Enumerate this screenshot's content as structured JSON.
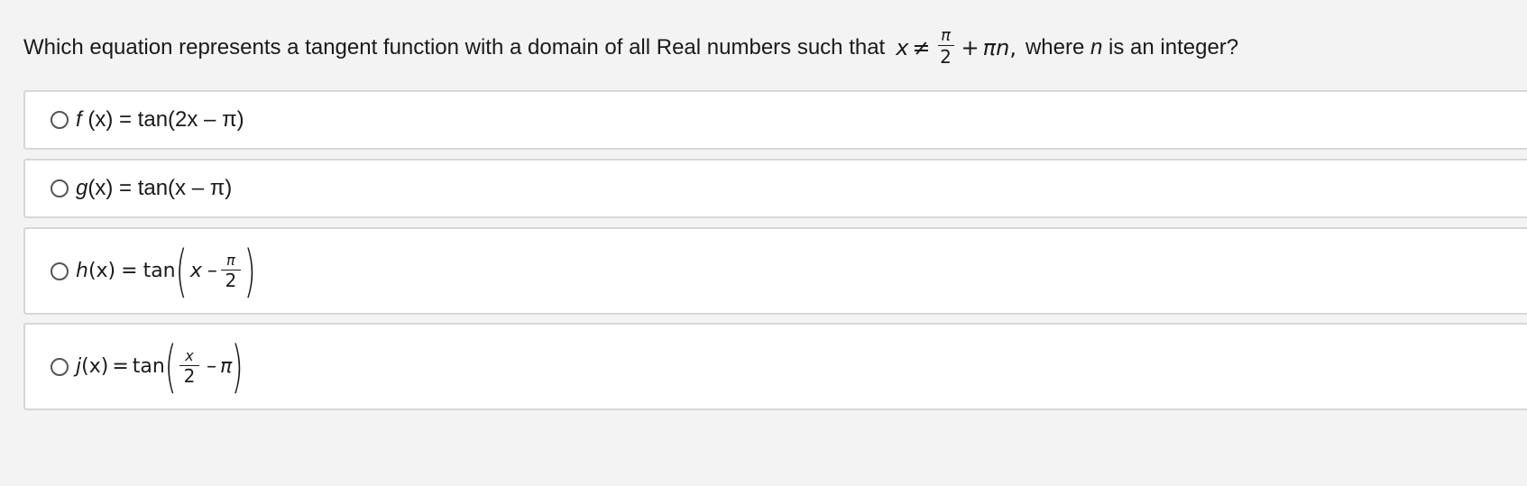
{
  "question": {
    "prefix": "Which equation represents a tangent function with a domain of all Real numbers such that",
    "math": {
      "var": "x",
      "neq": "≠",
      "frac_num": "π",
      "frac_den": "2",
      "plus": "+",
      "pin_pi": "π",
      "pin_n": "n",
      "comma": ","
    },
    "suffix_1": "where",
    "suffix_var": "n",
    "suffix_2": "is an integer?"
  },
  "options": [
    {
      "fn": "f",
      "rest": " (x) = tan(2x – π)"
    },
    {
      "fn": "g",
      "rest": "(x) = tan(x – π)"
    },
    {
      "fn": "h",
      "arg": "(x)",
      "eq": "=",
      "tan": "tan",
      "inner_var": "x",
      "minus": "–",
      "frac_num": "π",
      "frac_den": "2"
    },
    {
      "fn": "j",
      "arg": "(x)",
      "eq": "=",
      "tan": "tan",
      "frac_num": "x",
      "frac_den": "2",
      "minus": "–",
      "inner_const": "π"
    }
  ]
}
